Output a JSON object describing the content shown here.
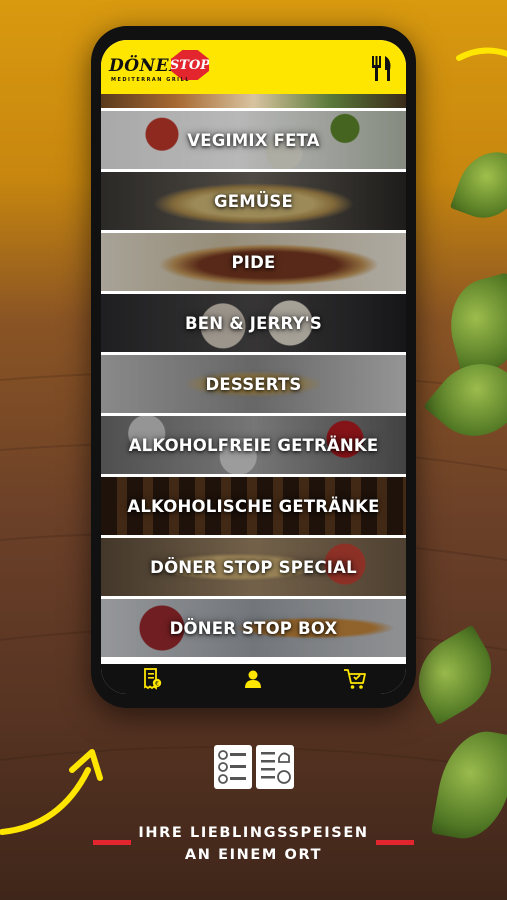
{
  "app": {
    "logo_text": "DÖNER",
    "logo_badge": "STOP",
    "logo_subtitle": "MEDITERRAN GRILL",
    "brand_color": "#ffe600",
    "accent_red": "#e3262e"
  },
  "header": {
    "menu_icon": "cutlery-icon"
  },
  "categories": [
    {
      "label": "VEGIMIX FETA"
    },
    {
      "label": "GEMÜSE"
    },
    {
      "label": "PIDE"
    },
    {
      "label": "BEN & JERRY'S"
    },
    {
      "label": "DESSERTS"
    },
    {
      "label": "ALKOHOLFREIE GETRÄNKE"
    },
    {
      "label": "ALKOHOLISCHE GETRÄNKE"
    },
    {
      "label": "DÖNER STOP SPECIAL"
    },
    {
      "label": "DÖNER STOP BOX"
    }
  ],
  "bottom_nav": [
    {
      "icon": "orders-receipt-icon"
    },
    {
      "icon": "user-icon"
    },
    {
      "icon": "cart-icon"
    }
  ],
  "tagline": {
    "line1": "IHRE LIEBLINGSSPEISEN",
    "line2": "AN EINEM ORT"
  }
}
